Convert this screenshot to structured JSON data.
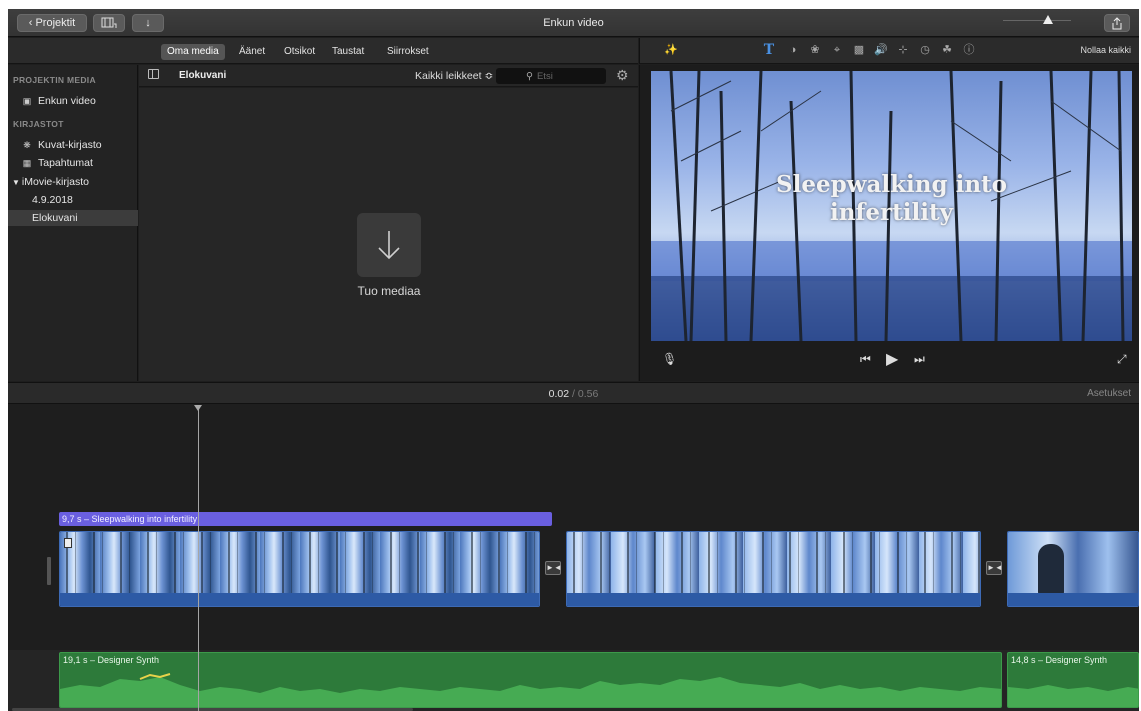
{
  "titlebar": {
    "projects_label": "Projektit",
    "window_title": "Enkun video"
  },
  "browser_tabs": [
    "Oma media",
    "Äänet",
    "Otsikot",
    "Taustat",
    "Siirrokset"
  ],
  "sidebar": {
    "project_media_header": "PROJEKTIN MEDIA",
    "project_item": "Enkun video",
    "libraries_header": "KIRJASTOT",
    "photos_library": "Kuvat-kirjasto",
    "events": "Tapahtumat",
    "imovie_library": "iMovie-kirjasto",
    "date_event": "4.9.2018",
    "movies": "Elokuvani"
  },
  "media": {
    "header_title": "Elokuvani",
    "filter_label": "Kaikki leikkeet ≎",
    "search_placeholder": "Etsi",
    "import_label": "Tuo mediaa"
  },
  "viewer": {
    "reset_all": "Nollaa kaikki",
    "title_text_line1": "Sleepwalking into",
    "title_text_line2": "infertility"
  },
  "timeline": {
    "current_time": "0.02",
    "separator": "/",
    "total_time": "0.56",
    "settings_label": "Asetukset",
    "title_clip_label": "9,7 s – Sleepwalking into infertility",
    "music_clip_1": "19,1 s – Designer Synth",
    "music_clip_2": "14,8 s – Designer Synth"
  },
  "colors": {
    "title_clip": "#6a5fe0",
    "music_clip": "#2d7a3a",
    "video_audio_strip": "#2d5aa5",
    "selected_sidebar": "#3c3c3c"
  }
}
